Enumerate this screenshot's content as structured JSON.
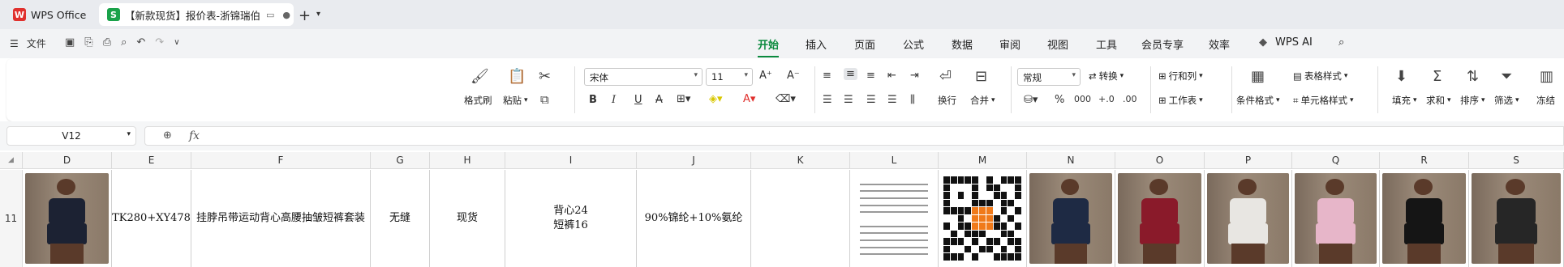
{
  "colors": {
    "accent": "#0b8a3e",
    "wps_red": "#e0302d",
    "sheet_green": "#1aa24a"
  },
  "titlebar": {
    "app_tab": "WPS Office",
    "doc_tab": "【新款现货】报价表-浙锦瑞伯",
    "doc_tab_icon": "S"
  },
  "menubar": {
    "file": "文件",
    "menus": [
      "开始",
      "插入",
      "页面",
      "公式",
      "数据",
      "审阅",
      "视图",
      "工具",
      "会员专享",
      "效率"
    ],
    "active": "开始",
    "wps_ai": "WPS AI"
  },
  "ribbon": {
    "format_painter": "格式刷",
    "paste": "粘贴",
    "font_name": "宋体",
    "font_size": "11",
    "wrap": "换行",
    "merge": "合并",
    "number_format": "常规",
    "convert": "转换",
    "row_col": "行和列",
    "worksheet": "工作表",
    "conditional_format": "条件格式",
    "table_style": "表格样式",
    "cell_style": "单元格样式",
    "fill": "填充",
    "sum": "求和",
    "sort": "排序",
    "filter": "筛选",
    "freeze": "冻结"
  },
  "formula_bar": {
    "name_box": "V12",
    "fx": "fx",
    "formula": ""
  },
  "grid": {
    "columns": [
      "D",
      "E",
      "F",
      "G",
      "H",
      "I",
      "J",
      "K",
      "L",
      "M",
      "N",
      "O",
      "P",
      "Q",
      "R",
      "S"
    ],
    "row_number": "11",
    "cells": {
      "E": "TK280+XY478",
      "F": "挂脖吊带运动背心高腰抽皱短裤套装",
      "G": "无缝",
      "H": "现货",
      "I1": "背心24",
      "I2": "短裤16",
      "J": "90%锦纶+10%氨纶",
      "K": ""
    },
    "photo_colors": [
      "#1c2233",
      "#1e2a44",
      "#8a1a2a",
      "#e8e6e2",
      "#e7b6c9",
      "#151515",
      "#262626"
    ]
  }
}
